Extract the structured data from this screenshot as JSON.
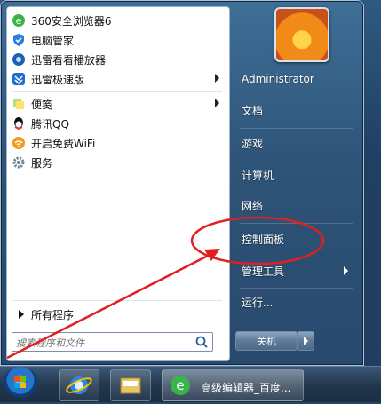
{
  "start_menu": {
    "programs": [
      {
        "label": "360安全浏览器6",
        "icon": "360-browser-icon"
      },
      {
        "label": "电脑管家",
        "icon": "pc-manager-icon"
      },
      {
        "label": "迅雷看看播放器",
        "icon": "xunlei-player-icon"
      },
      {
        "label": "迅雷极速版",
        "icon": "xunlei-fast-icon",
        "has_submenu": true
      },
      {
        "label": "便笺",
        "icon": "sticky-notes-icon",
        "has_submenu": true
      },
      {
        "label": "腾讯QQ",
        "icon": "qq-icon"
      },
      {
        "label": "开启免费WiFi",
        "icon": "wifi-icon"
      },
      {
        "label": "服务",
        "icon": "services-icon"
      }
    ],
    "all_programs_label": "所有程序",
    "search_placeholder": "搜索程序和文件",
    "right_items": [
      {
        "label": "Administrator"
      },
      {
        "label": "文档"
      },
      {
        "label": "游戏"
      },
      {
        "label": "计算机"
      },
      {
        "label": "网络"
      },
      {
        "label": "控制面板"
      },
      {
        "label": "管理工具",
        "has_submenu": true
      },
      {
        "label": "运行..."
      }
    ],
    "shutdown_label": "关机"
  },
  "taskbar": {
    "active_window_label": "高级编辑器_百度..."
  },
  "colors": {
    "annotation": "#e02020"
  }
}
